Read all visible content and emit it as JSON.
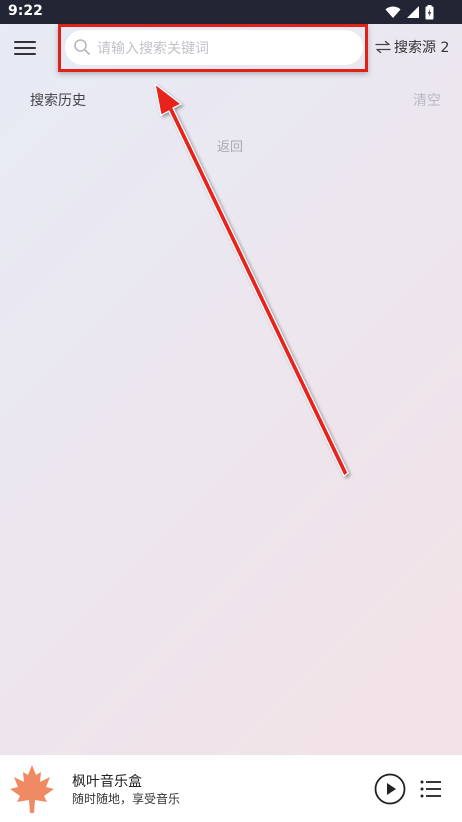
{
  "status_bar": {
    "time": "9:22"
  },
  "search": {
    "placeholder": "请输入搜索关键词",
    "value": ""
  },
  "source": {
    "label": "搜索源 2"
  },
  "history": {
    "title": "搜索历史",
    "clear_label": "清空"
  },
  "back_label": "返回",
  "player": {
    "title": "枫叶音乐盒",
    "subtitle": "随时随地，享受音乐"
  },
  "colors": {
    "highlight": "#e0221b",
    "accent_cover": "#f08a64",
    "status_bar": "#222634"
  },
  "icons": {
    "menu": "hamburger-menu-icon",
    "search": "search-icon",
    "swap": "swap-arrows-icon",
    "play": "play-circle-icon",
    "playlist": "playlist-icon",
    "cover": "maple-leaf-icon"
  }
}
